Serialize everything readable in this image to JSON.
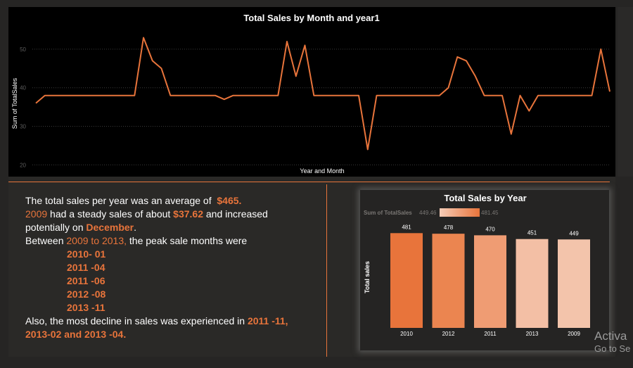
{
  "line_chart_data": {
    "type": "line",
    "title": "Total Sales by Month and year1",
    "xlabel": "Year and Month",
    "ylabel": "Sum of TotalSales",
    "ylim": [
      17.5,
      54
    ],
    "yticks": [
      20,
      30,
      40,
      50
    ],
    "grid": true,
    "color": "#e8743b",
    "values": [
      36,
      38,
      38,
      38,
      38,
      38,
      38,
      38,
      38,
      38,
      38,
      38,
      53,
      47,
      45,
      38,
      38,
      38,
      38,
      38,
      38,
      37,
      38,
      38,
      38,
      38,
      38,
      38,
      52,
      43,
      51,
      38,
      38,
      38,
      38,
      38,
      38,
      24,
      38,
      38,
      38,
      38,
      38,
      38,
      38,
      38,
      40,
      48,
      47,
      43,
      38,
      38,
      38,
      28,
      38,
      34,
      38,
      38,
      38,
      38,
      38,
      38,
      38,
      50,
      39
    ]
  },
  "chart_data": {
    "type": "bar",
    "title": "Total Sales by Year",
    "ylabel": "Total sales",
    "categories": [
      "2010",
      "2012",
      "2011",
      "2013",
      "2009"
    ],
    "values": [
      481,
      478,
      470,
      451,
      449
    ],
    "colors": [
      "#e8743b",
      "#eb8550",
      "#ef9c73",
      "#f3bfa5",
      "#f3c4ab"
    ],
    "ylim": [
      0,
      500
    ],
    "legend": {
      "label": "Sum of TotalSales",
      "min": "449.46",
      "max": "481.45"
    }
  },
  "narrative": {
    "l1_text": "The total sales per year was an average of",
    "l1_value": "$465.",
    "l2_year": "2009",
    "l2_text": " had a steady sales of about ",
    "l2_value": "$37.62",
    "l2_tail": " and increased",
    "l3_text": "potentially on ",
    "l3_month": "December",
    "l3_tail": ".",
    "l4_text": "Between ",
    "l4_range": "2009 to 2013,",
    "l4_tail": " the peak sale months were",
    "peaks": [
      "2010- 01",
      "2011 -04",
      "2011 -06",
      "2012 -08",
      "2013 -11"
    ],
    "l10_text": "Also, the most decline in sales was experienced in ",
    "l10_value": "2011 -11,",
    "l11_value": "2013-02 and 2013 -04."
  },
  "watermark": {
    "line1": "Activa",
    "line2": "Go to Se"
  }
}
